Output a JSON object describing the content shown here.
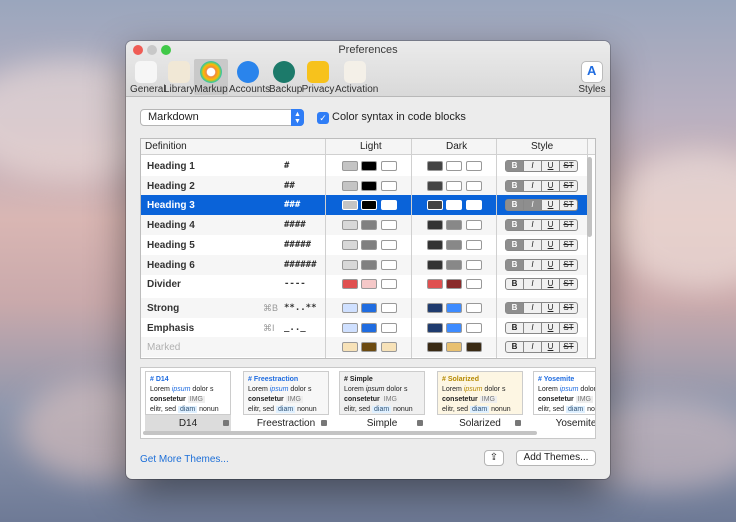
{
  "window": {
    "title": "Preferences"
  },
  "toolbar": {
    "items": [
      {
        "label": "General",
        "icon": "phone-icon"
      },
      {
        "label": "Library",
        "icon": "library-icon"
      },
      {
        "label": "Markup",
        "icon": "color-wheel-icon",
        "selected": true
      },
      {
        "label": "Accounts",
        "icon": "account-icon"
      },
      {
        "label": "Backup",
        "icon": "backup-icon"
      },
      {
        "label": "Privacy",
        "icon": "lock-icon"
      },
      {
        "label": "Activation",
        "icon": "certificate-icon"
      }
    ],
    "styles_label": "Styles"
  },
  "markup": {
    "language": "Markdown",
    "color_syntax_label": "Color syntax in code blocks",
    "color_syntax_checked": true
  },
  "table": {
    "headers": {
      "definition": "Definition",
      "light": "Light",
      "dark": "Dark",
      "style": "Style"
    },
    "style_buttons": [
      "B",
      "I",
      "U",
      "ST"
    ],
    "rows": [
      {
        "name": "Heading 1",
        "shortcut": "",
        "markup": "#",
        "light": [
          "#c4c4c4",
          "#000000",
          "#ffffff"
        ],
        "dark": [
          "#444444",
          "#ffffff",
          "#ffffff"
        ],
        "bold": true
      },
      {
        "name": "Heading 2",
        "shortcut": "",
        "markup": "##",
        "light": [
          "#c4c4c4",
          "#000000",
          "#ffffff"
        ],
        "dark": [
          "#444444",
          "#ffffff",
          "#ffffff"
        ],
        "bold": true
      },
      {
        "name": "Heading 3",
        "shortcut": "",
        "markup": "###",
        "light": [
          "#c4c4c4",
          "#000000",
          "#ffffff"
        ],
        "dark": [
          "#444444",
          "#ffffff",
          "#ffffff"
        ],
        "bold": true,
        "selected": true
      },
      {
        "name": "Heading 4",
        "shortcut": "",
        "markup": "####",
        "light": [
          "#d8d8d8",
          "#808080",
          "#ffffff"
        ],
        "dark": [
          "#333333",
          "#888888",
          "#ffffff"
        ],
        "bold": true
      },
      {
        "name": "Heading 5",
        "shortcut": "",
        "markup": "#####",
        "light": [
          "#d8d8d8",
          "#808080",
          "#ffffff"
        ],
        "dark": [
          "#333333",
          "#888888",
          "#ffffff"
        ],
        "bold": true
      },
      {
        "name": "Heading 6",
        "shortcut": "",
        "markup": "######",
        "light": [
          "#d8d8d8",
          "#808080",
          "#ffffff"
        ],
        "dark": [
          "#333333",
          "#888888",
          "#ffffff"
        ],
        "bold": true
      },
      {
        "name": "Divider",
        "shortcut": "",
        "markup": "----",
        "light": [
          "#e05050",
          "#f5c8c8",
          "#ffffff"
        ],
        "dark": [
          "#e05050",
          "#8a2a2a",
          "#ffffff"
        ],
        "bold": false
      },
      {
        "name": "Strong",
        "shortcut": "⌘B",
        "markup": "**..**",
        "light": [
          "#cfe0ff",
          "#1f6ce0",
          "#ffffff"
        ],
        "dark": [
          "#1f3b6e",
          "#3d8bff",
          "#ffffff"
        ],
        "bold": true
      },
      {
        "name": "Emphasis",
        "shortcut": "⌘I",
        "markup": "_.._",
        "light": [
          "#cfe0ff",
          "#1f6ce0",
          "#ffffff"
        ],
        "dark": [
          "#1f3b6e",
          "#3d8bff",
          "#ffffff"
        ],
        "bold": false
      },
      {
        "name": "Marked",
        "shortcut": "",
        "markup": "",
        "light": [
          "#f7e2b8",
          "#6b4a10",
          "#f7e2b8"
        ],
        "dark": [
          "#3a2a14",
          "#e8c070",
          "#3a2a14"
        ],
        "bold": false,
        "dim": true
      }
    ]
  },
  "themes": [
    {
      "name": "D14",
      "heading": "D14",
      "line1a": "Lorem ",
      "line1b": "ipsum",
      "line1c": " dolor s",
      "line2a": "consetetur",
      "line2b": "IMG",
      "line3a": "elitr, sed ",
      "line3b": "diam",
      "line3c": " nonun",
      "bg": "#ffffff",
      "accent": "#1f6ce0",
      "selected": true
    },
    {
      "name": "Freestraction",
      "heading": "Freestraction",
      "line1a": "Lorem ",
      "line1b": "ipsum",
      "line1c": " dolor s",
      "line2a": "consetetur",
      "line2b": "IMG",
      "line3a": "elitr, sed ",
      "line3b": "diam",
      "line3c": " nonun",
      "bg": "#f7f7f7",
      "accent": "#1f6ce0"
    },
    {
      "name": "Simple",
      "heading": "Simple",
      "line1a": "Lorem ",
      "line1b": "ipsum",
      "line1c": " dolor s",
      "line2a": "consetetur",
      "line2b": "IMG",
      "line3a": "elitr, sed ",
      "line3b": "diam",
      "line3c": " nonun",
      "bg": "#f0f0f0",
      "accent": "#222222"
    },
    {
      "name": "Solarized",
      "heading": "Solarized",
      "line1a": "Lorem ",
      "line1b": "ipsum",
      "line1c": " dolor s",
      "line2a": "consetetur",
      "line2b": "IMG",
      "line3a": "elitr, sed ",
      "line3b": "diam",
      "line3c": " nonun",
      "bg": "#fdf6e3",
      "accent": "#b58900"
    },
    {
      "name": "Yosemite",
      "heading": "Yosemite",
      "line1a": "Lorem ",
      "line1b": "ipsum",
      "line1c": " dolor s",
      "line2a": "consetetur",
      "line2b": "IMG",
      "line3a": "elitr, sed ",
      "line3b": "diam",
      "line3c": " nonun",
      "bg": "#ffffff",
      "accent": "#1f6ce0"
    }
  ],
  "footer": {
    "get_more_label": "Get More Themes...",
    "share_icon": "share-icon",
    "add_themes_label": "Add Themes..."
  }
}
